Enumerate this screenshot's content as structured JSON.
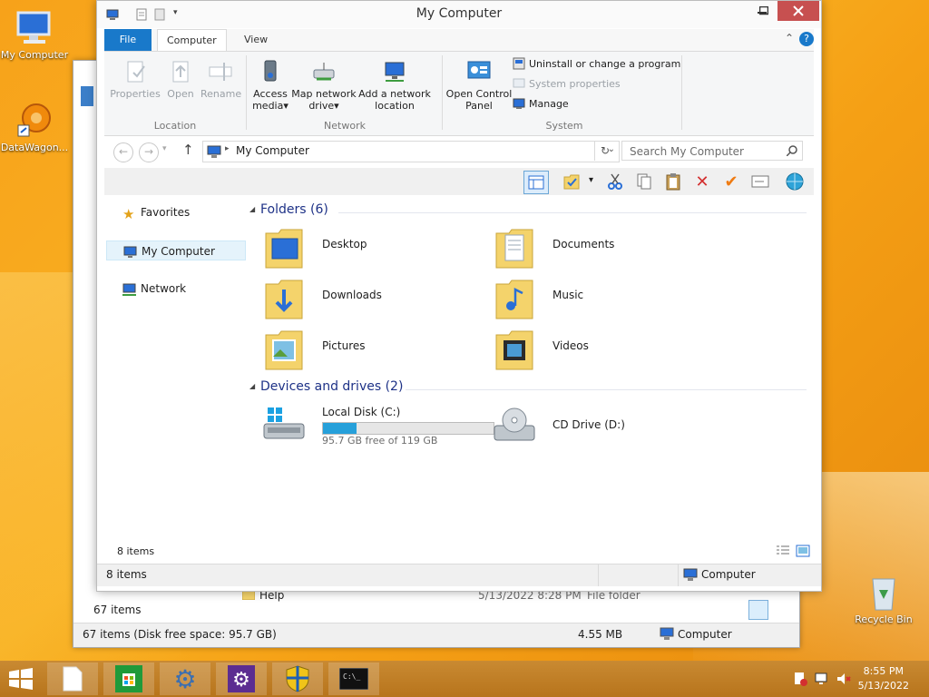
{
  "desktop": {
    "icons": [
      {
        "label": "My Computer"
      },
      {
        "label": "DataWagon..."
      },
      {
        "label": "Recycle Bin"
      }
    ]
  },
  "back_window": {
    "row_name": "Help",
    "row_date": "5/13/2022 8:28 PM",
    "row_type": "File folder",
    "items_text": "67 items",
    "status_left": "67 items (Disk free space: 95.7 GB)",
    "status_size": "4.55 MB",
    "status_right": "Computer"
  },
  "window": {
    "title": "My Computer",
    "tabs": {
      "file": "File",
      "computer": "Computer",
      "view": "View"
    },
    "ribbon": {
      "location": {
        "label": "Location",
        "properties": "Properties",
        "open": "Open",
        "rename": "Rename"
      },
      "network": {
        "label": "Network",
        "access_media_1": "Access",
        "access_media_2": "media",
        "map_drive_1": "Map network",
        "map_drive_2": "drive",
        "add_location_1": "Add a network",
        "add_location_2": "location"
      },
      "system": {
        "label": "System",
        "open_cp_1": "Open Control",
        "open_cp_2": "Panel",
        "uninstall": "Uninstall or change a program",
        "sys_props": "System properties",
        "manage": "Manage"
      }
    },
    "address": "My Computer",
    "search_placeholder": "Search My Computer",
    "nav": {
      "favorites": "Favorites",
      "my_computer": "My Computer",
      "network": "Network"
    },
    "folders_header": "Folders (6)",
    "folders": [
      {
        "name": "Desktop"
      },
      {
        "name": "Documents"
      },
      {
        "name": "Downloads"
      },
      {
        "name": "Music"
      },
      {
        "name": "Pictures"
      },
      {
        "name": "Videos"
      }
    ],
    "drives_header": "Devices and drives (2)",
    "drives": [
      {
        "name": "Local Disk (C:)",
        "free": "95.7 GB free of 119 GB",
        "used_fraction": 0.196
      },
      {
        "name": "CD Drive (D:)"
      }
    ],
    "inner_status": "8 items",
    "status_left": "8 items",
    "status_right": "Computer"
  },
  "taskbar": {
    "time": "8:55 PM",
    "date": "5/13/2022"
  }
}
